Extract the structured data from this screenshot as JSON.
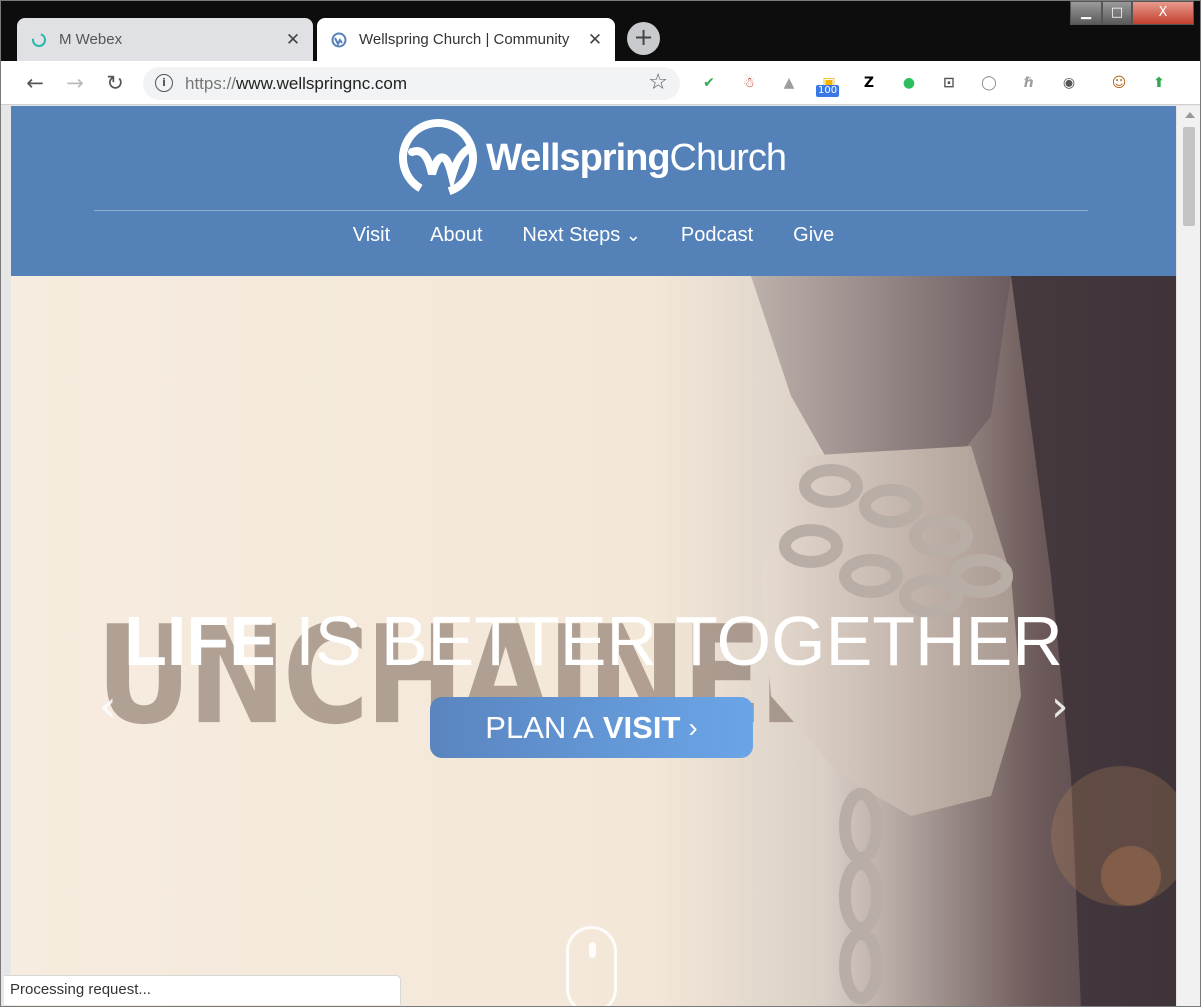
{
  "browser": {
    "tabs": [
      {
        "title": "M Webex",
        "close": "✕",
        "active": false
      },
      {
        "title": "Wellspring Church | Community",
        "close": "✕",
        "active": true
      }
    ],
    "new_tab": "+",
    "window_controls": {
      "minimize": "▁",
      "maximize": "□",
      "close": "X"
    },
    "nav": {
      "back": "←",
      "forward": "→",
      "reload": "↻"
    },
    "address": {
      "scheme": "https://",
      "host": "www.wellspringnc.com",
      "info": "i",
      "bookmark": "☆"
    },
    "extensions": [
      {
        "name": "checkmark-extension-icon",
        "glyph": "✔",
        "color": "#34a853"
      },
      {
        "name": "santa-extension-icon",
        "glyph": "☃",
        "color": "#c0392b"
      },
      {
        "name": "drive-extension-icon",
        "glyph": "▲",
        "color": "#9e9e9e"
      },
      {
        "name": "folder-extension-icon",
        "glyph": "▣",
        "color": "#f4b400",
        "badge": "100"
      },
      {
        "name": "zotero-extension-icon",
        "glyph": "Z",
        "color": "#000000"
      },
      {
        "name": "evernote-extension-icon",
        "glyph": "●",
        "color": "#2dbe60"
      },
      {
        "name": "cast-extension-icon",
        "glyph": "⊡",
        "color": "#555555"
      },
      {
        "name": "circle-extension-icon",
        "glyph": "◯",
        "color": "#8a8a8a"
      },
      {
        "name": "tilde-extension-icon",
        "glyph": "ℏ",
        "color": "#9e9e9e"
      },
      {
        "name": "eye-extension-icon",
        "glyph": "◉",
        "color": "#555555"
      },
      {
        "name": "profile-avatar",
        "glyph": "☺",
        "color": "#b5651d"
      },
      {
        "name": "update-extension-icon",
        "glyph": "⬆",
        "color": "#34a853"
      }
    ]
  },
  "site": {
    "brand": {
      "bold": "Wellspring",
      "light": "Church"
    },
    "nav": [
      {
        "label": "Visit"
      },
      {
        "label": "About"
      },
      {
        "label": "Next Steps",
        "chevron": "⌄"
      },
      {
        "label": "Podcast"
      },
      {
        "label": "Give"
      }
    ],
    "hero": {
      "headline_strong": "LIFE",
      "headline_rest": " IS BETTER TOGETHER",
      "background_word": "UNCHAINED",
      "cta_light": "PLAN A",
      "cta_strong": "VISIT",
      "cta_chevron": "›",
      "prev": "‹",
      "next": "›"
    }
  },
  "status_bar": {
    "text": "Processing request..."
  },
  "colors": {
    "header": "#5481b8",
    "cta_start": "#5a85bf",
    "cta_end": "#6aa5e8"
  }
}
